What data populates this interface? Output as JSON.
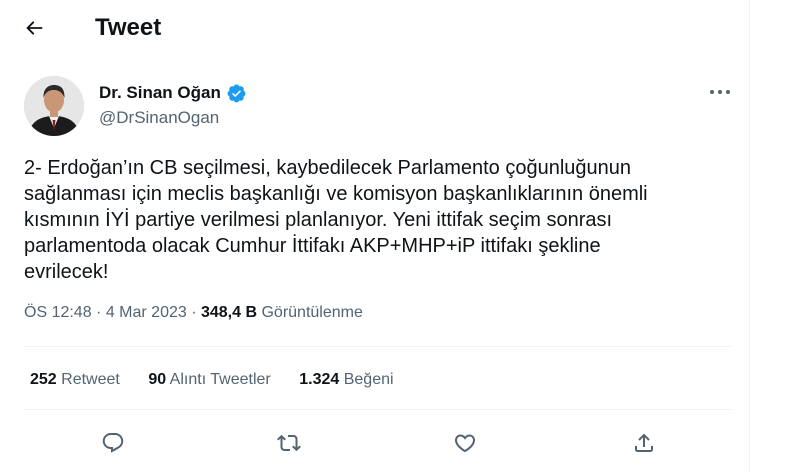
{
  "header": {
    "title": "Tweet",
    "back_icon": "arrow-left-icon"
  },
  "author": {
    "display_name": "Dr. Sinan Oğan",
    "handle": "@DrSinanOgan",
    "verified_color": "#1d9bf0"
  },
  "tweet": {
    "lines": [
      "2- Erdoğan’ın CB seçilmesi, kaybedilecek Parlamento çoğunluğunun",
      "sağlanması için meclis başkanlığı ve komisyon başkanlıklarının önemli",
      "kısmının İYİ partiye verilmesi planlanıyor. Yeni ittifak seçim sonrası",
      "parlamentoda olacak Cumhur İttifakı AKP+MHP+iP ittifakı şekline",
      "evrilecek!"
    ]
  },
  "meta": {
    "time": "ÖS 12:48 · 4 Mar 2023",
    "separator": " · ",
    "views_count": "348,4 B",
    "views_label": "Görüntülenme"
  },
  "stats": {
    "retweets_count": "252",
    "retweets_label": "Retweet",
    "quotes_count": "90",
    "quotes_label": "Alıntı Tweetler",
    "likes_count": "1.324",
    "likes_label": "Beğeni"
  },
  "actions": [
    "reply-icon",
    "retweet-icon",
    "like-icon",
    "share-icon"
  ],
  "colors": {
    "text": "#0f1419",
    "secondary": "#536471",
    "border": "#eff3f4",
    "accent": "#1d9bf0"
  }
}
